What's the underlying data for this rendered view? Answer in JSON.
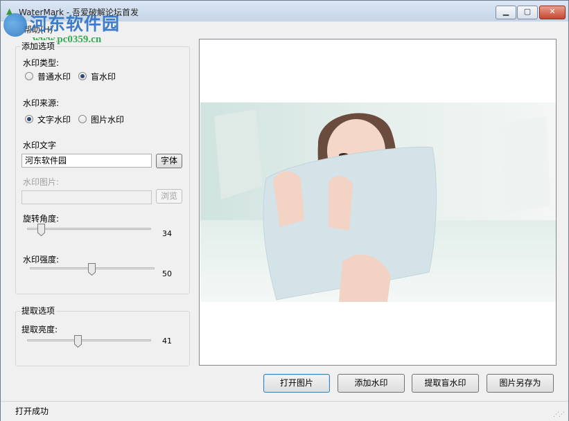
{
  "window": {
    "title": "WaterMark - 吾爱破解论坛首发",
    "menu": "帮助(H)"
  },
  "watermark_logo": {
    "name": "河东软件园",
    "url": "www.pc0359.cn"
  },
  "add_options": {
    "group_title": "添加选项",
    "type_label": "水印类型:",
    "type_options": [
      {
        "label": "普通水印",
        "checked": false
      },
      {
        "label": "盲水印",
        "checked": true
      }
    ],
    "source_label": "水印来源:",
    "source_options": [
      {
        "label": "文字水印",
        "checked": true
      },
      {
        "label": "图片水印",
        "checked": false
      }
    ],
    "text_label": "水印文字",
    "text_value": "河东软件园",
    "font_button": "字体",
    "image_label": "水印图片:",
    "image_value": "",
    "browse_button": "浏览",
    "rotation_label": "旋转角度:",
    "rotation_value": "34",
    "rotation_min": 0,
    "rotation_max": 360,
    "strength_label": "水印强度:",
    "strength_value": "50",
    "strength_min": 0,
    "strength_max": 100
  },
  "extract_options": {
    "group_title": "提取选项",
    "brightness_label": "提取亮度:",
    "brightness_value": "41",
    "brightness_min": 0,
    "brightness_max": 100
  },
  "actions": {
    "open_image": "打开图片",
    "add_watermark": "添加水印",
    "extract_watermark": "提取盲水印",
    "save_as": "图片另存为"
  },
  "status": {
    "text": "打开成功"
  },
  "colors": {
    "title_gradient_top": "#dbe6f3",
    "close_button": "#c7462f",
    "logo_blue": "#2a72c4",
    "logo_green": "#2aa84a"
  }
}
